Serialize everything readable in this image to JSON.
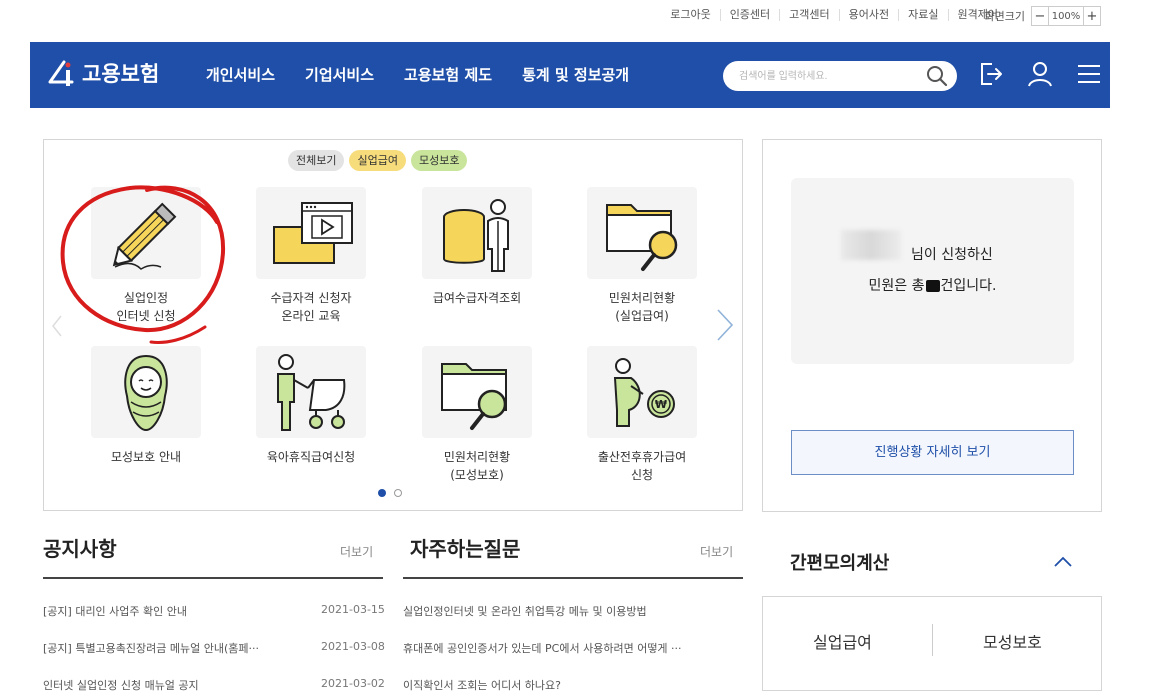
{
  "util": {
    "links": [
      "로그아웃",
      "인증센터",
      "고객센터",
      "용어사전",
      "자료실",
      "원격제어"
    ],
    "zoom_label": "화면크기",
    "zoom_minus": "−",
    "zoom_value": "100%",
    "zoom_plus": "+"
  },
  "nav": {
    "logo_text": "고용보험",
    "menu": [
      "개인서비스",
      "기업서비스",
      "고용보험 제도",
      "통계 및 정보공개"
    ],
    "search_placeholder": "검색어를 입력하세요.",
    "icons": [
      "search-icon",
      "logout-icon",
      "user-icon",
      "menu-icon"
    ],
    "brand_color": "#1f4fa8"
  },
  "service": {
    "filters": [
      "전체보기",
      "실업급여",
      "모성보호"
    ],
    "items": [
      {
        "label": "실업인정\n인터넷 신청",
        "icon": "pencil-icon"
      },
      {
        "label": "수급자격 신청자\n온라인 교육",
        "icon": "online-education-icon"
      },
      {
        "label": "급여수급자격조회",
        "icon": "database-person-icon"
      },
      {
        "label": "민원처리현황\n(실업급여)",
        "icon": "folder-search-icon"
      },
      {
        "label": "모성보호 안내",
        "icon": "baby-icon"
      },
      {
        "label": "육아휴직급여신청",
        "icon": "stroller-icon"
      },
      {
        "label": "민원처리현황\n(모성보호)",
        "icon": "folder-search-icon"
      },
      {
        "label": "출산전후휴가급여\n신청",
        "icon": "pregnant-coin-icon"
      }
    ],
    "page_count": 2,
    "active_page": 1
  },
  "status": {
    "line1": "님이 신청하신",
    "line2_a": "민원은 총",
    "line2_b": "건입니다.",
    "button": "진행상황 자세히 보기"
  },
  "notice": {
    "title": "공지사항",
    "more": "더보기",
    "rows": [
      {
        "title": "[공지] 대리인 사업주 확인 안내",
        "date": "2021-03-15"
      },
      {
        "title": "[공지] 특별고용촉진장려금 메뉴얼 안내(홈페···",
        "date": "2021-03-08"
      },
      {
        "title": "인터넷 실업인정 신청 매뉴얼 공지",
        "date": "2021-03-02"
      }
    ]
  },
  "faq": {
    "title": "자주하는질문",
    "more": "더보기",
    "rows": [
      "실업인정인터넷 및 온라인 취업특강 메뉴 및 이용방법",
      "휴대폰에 공인인증서가 있는데 PC에서 사용하려면 어떻게 ···",
      "이직확인서 조회는 어디서 하나요?"
    ]
  },
  "calc": {
    "title": "간편모의계산",
    "items": [
      "실업급여",
      "모성보호"
    ]
  }
}
